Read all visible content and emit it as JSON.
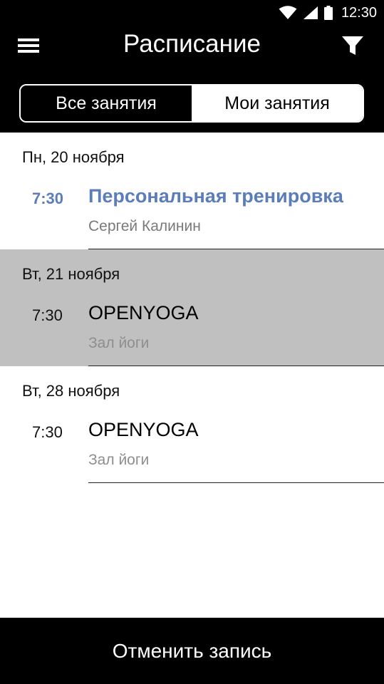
{
  "status": {
    "time": "12:30"
  },
  "header": {
    "title": "Расписание"
  },
  "tabs": [
    {
      "label": "Все занятия"
    },
    {
      "label": "Мои занятия"
    }
  ],
  "sessions": [
    {
      "date": "Пн, 20 ноября",
      "time": "7:30",
      "name": "Персональная тренировка",
      "detail": "Сергей Калинин"
    },
    {
      "date": "Вт, 21 ноября",
      "time": "7:30",
      "name": "OPENYOGA",
      "detail": "Зал йоги"
    },
    {
      "date": "Вт, 28 ноября",
      "time": "7:30",
      "name": "OPENYOGA",
      "detail": "Зал йоги"
    }
  ],
  "footer": {
    "cancel_label": "Отменить запись"
  },
  "colors": {
    "accent": "#5b7dba",
    "selected_row": "#c0c0c0",
    "bar": "#000000"
  }
}
